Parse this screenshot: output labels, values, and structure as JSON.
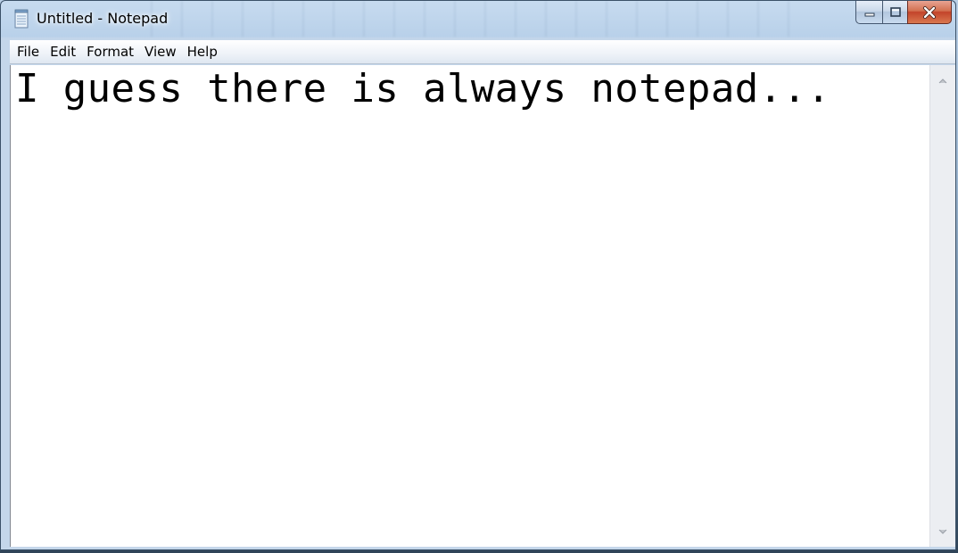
{
  "window": {
    "title": "Untitled - Notepad"
  },
  "caption_buttons": {
    "minimize_icon": "minimize-icon",
    "maximize_icon": "maximize-icon",
    "close_icon": "close-icon"
  },
  "menubar": {
    "items": [
      {
        "label": "File"
      },
      {
        "label": "Edit"
      },
      {
        "label": "Format"
      },
      {
        "label": "View"
      },
      {
        "label": "Help"
      }
    ]
  },
  "editor": {
    "content": "I guess there is always notepad..."
  },
  "colors": {
    "title_bar": "#b9d1ea",
    "close_button": "#c3432a",
    "editor_background": "#ffffff"
  }
}
